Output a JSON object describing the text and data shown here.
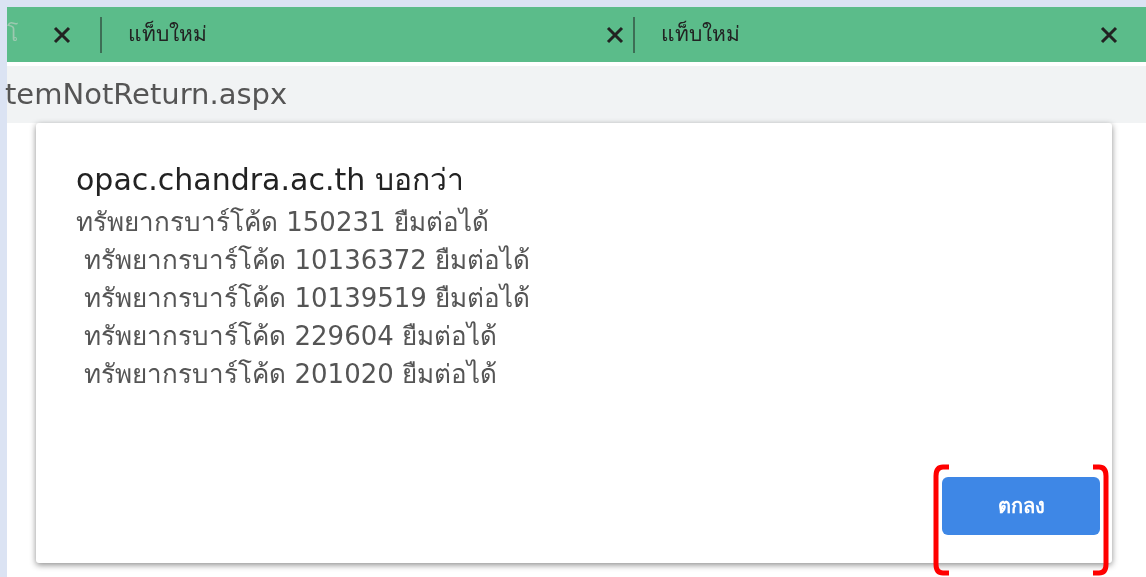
{
  "tabs": [
    {
      "label": "โ",
      "faded": true
    },
    {
      "label": "แท็บใหม่",
      "faded": false
    },
    {
      "label": "แท็บใหม่",
      "faded": false
    }
  ],
  "address_bar": {
    "url": "temNotReturn.aspx"
  },
  "dialog": {
    "title": "opac.chandra.ac.th บอกว่า",
    "lines": [
      "ทรัพยากรบาร์โค้ด 150231 ยืมต่อได้",
      " ทรัพยากรบาร์โค้ด 10136372 ยืมต่อได้",
      " ทรัพยากรบาร์โค้ด 10139519 ยืมต่อได้",
      " ทรัพยากรบาร์โค้ด 229604 ยืมต่อได้",
      " ทรัพยากรบาร์โค้ด 201020 ยืมต่อได้"
    ],
    "ok_button": {
      "label": "ตกลง",
      "highlighted": true
    }
  }
}
